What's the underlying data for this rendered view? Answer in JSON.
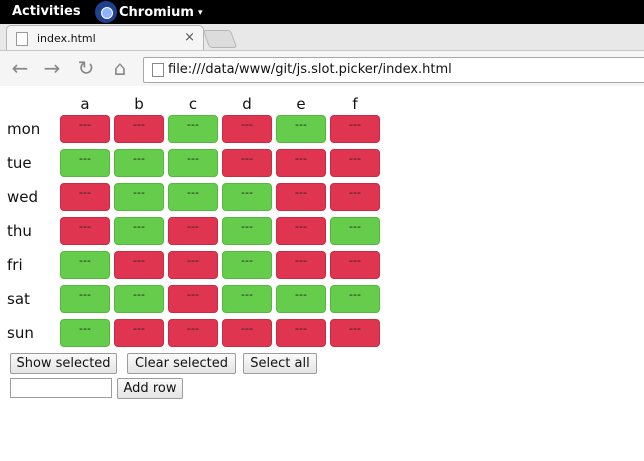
{
  "topbar": {
    "activities": "Activities",
    "app_name": "Chromium",
    "app_caret": "▾"
  },
  "browser": {
    "tab_title": "index.html",
    "tab_close": "×",
    "url": "file:///data/www/git/js.slot.picker/index.html",
    "nav_icons": {
      "back": "←",
      "forward": "→",
      "reload": "↻",
      "home": "⌂"
    }
  },
  "grid": {
    "columns": [
      "a",
      "b",
      "c",
      "d",
      "e",
      "f"
    ],
    "rows": [
      {
        "label": "mon",
        "cells": [
          {
            "text": "---",
            "state": "red"
          },
          {
            "text": "---",
            "state": "red"
          },
          {
            "text": "---",
            "state": "green"
          },
          {
            "text": "---",
            "state": "red"
          },
          {
            "text": "---",
            "state": "green"
          },
          {
            "text": "---",
            "state": "red"
          }
        ]
      },
      {
        "label": "tue",
        "cells": [
          {
            "text": "---",
            "state": "green"
          },
          {
            "text": "---",
            "state": "green"
          },
          {
            "text": "---",
            "state": "green"
          },
          {
            "text": "---",
            "state": "red"
          },
          {
            "text": "---",
            "state": "red"
          },
          {
            "text": "---",
            "state": "red"
          }
        ]
      },
      {
        "label": "wed",
        "cells": [
          {
            "text": "---",
            "state": "red"
          },
          {
            "text": "---",
            "state": "green"
          },
          {
            "text": "---",
            "state": "green"
          },
          {
            "text": "---",
            "state": "green"
          },
          {
            "text": "---",
            "state": "red"
          },
          {
            "text": "---",
            "state": "red"
          }
        ]
      },
      {
        "label": "thu",
        "cells": [
          {
            "text": "---",
            "state": "red"
          },
          {
            "text": "---",
            "state": "green"
          },
          {
            "text": "---",
            "state": "red"
          },
          {
            "text": "---",
            "state": "green"
          },
          {
            "text": "---",
            "state": "red"
          },
          {
            "text": "---",
            "state": "green"
          }
        ]
      },
      {
        "label": "fri",
        "cells": [
          {
            "text": "---",
            "state": "green"
          },
          {
            "text": "---",
            "state": "red"
          },
          {
            "text": "---",
            "state": "red"
          },
          {
            "text": "---",
            "state": "green"
          },
          {
            "text": "---",
            "state": "red"
          },
          {
            "text": "---",
            "state": "red"
          }
        ]
      },
      {
        "label": "sat",
        "cells": [
          {
            "text": "---",
            "state": "green"
          },
          {
            "text": "---",
            "state": "green"
          },
          {
            "text": "---",
            "state": "red"
          },
          {
            "text": "---",
            "state": "green"
          },
          {
            "text": "---",
            "state": "green"
          },
          {
            "text": "---",
            "state": "green"
          }
        ]
      },
      {
        "label": "sun",
        "cells": [
          {
            "text": "---",
            "state": "green"
          },
          {
            "text": "---",
            "state": "red"
          },
          {
            "text": "---",
            "state": "red"
          },
          {
            "text": "---",
            "state": "red"
          },
          {
            "text": "---",
            "state": "red"
          },
          {
            "text": "---",
            "state": "red"
          }
        ]
      }
    ],
    "colors": {
      "red": "#e03550",
      "green": "#66cc4c"
    }
  },
  "controls": {
    "show_selected": "Show selected",
    "clear_selected": "Clear selected",
    "select_all": "Select all",
    "row_input_value": "",
    "add_row": "Add row"
  }
}
